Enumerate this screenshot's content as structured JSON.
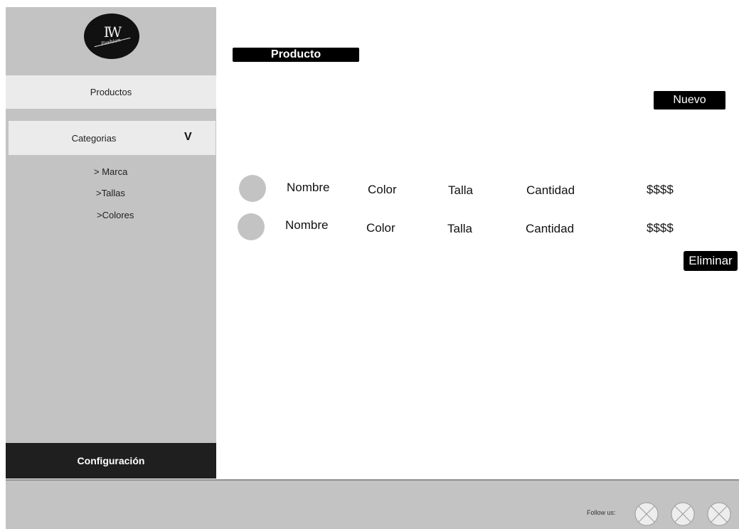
{
  "brand": {
    "logo_text": "IW",
    "logo_script": "Fashion"
  },
  "sidebar": {
    "items": [
      {
        "label": "Productos"
      },
      {
        "label": "Categorias",
        "chevron": "V"
      }
    ],
    "subitems": [
      {
        "label": "> Marca"
      },
      {
        "label": ">Tallas"
      },
      {
        "label": ">Colores"
      }
    ],
    "config_label": "Configuración"
  },
  "main": {
    "title": "Producto",
    "new_button": "Nuevo",
    "delete_button": "Eliminar",
    "rows": [
      {
        "nombre": "Nombre",
        "color": "Color",
        "talla": "Talla",
        "cantidad": "Cantidad",
        "precio": "$$$$"
      },
      {
        "nombre": "Nombre",
        "color": "Color",
        "talla": "Talla",
        "cantidad": "Cantidad",
        "precio": "$$$$"
      }
    ]
  },
  "footer": {
    "follow_label": "Follow us:",
    "social_icons": [
      "social-placeholder-icon",
      "social-placeholder-icon",
      "social-placeholder-icon"
    ]
  },
  "colors": {
    "sidebar_bg": "#c3c3c3",
    "nav_item_bg": "#ebebeb",
    "dark": "#1f1f1f",
    "black": "#000000"
  }
}
